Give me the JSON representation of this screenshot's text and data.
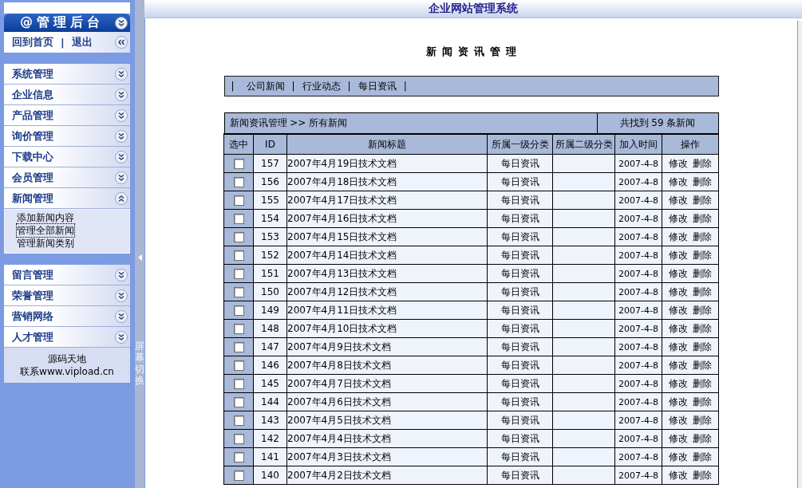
{
  "sidebar": {
    "header": {
      "title": "@管理后台"
    },
    "home_bar": {
      "links": [
        "回到首页",
        "退出"
      ],
      "separators": [
        "|"
      ]
    },
    "menu_groups": [
      {
        "items": [
          {
            "label": "系统管理",
            "expanded": false
          },
          {
            "label": "企业信息",
            "expanded": false
          },
          {
            "label": "产品管理",
            "expanded": false
          },
          {
            "label": "询价管理",
            "expanded": false
          },
          {
            "label": "下载中心",
            "expanded": false
          },
          {
            "label": "会员管理",
            "expanded": false
          },
          {
            "label": "新闻管理",
            "expanded": true,
            "children": [
              {
                "label": "添加新闻内容",
                "focused": false
              },
              {
                "label": "管理全部新闻",
                "focused": true
              },
              {
                "label": "管理新闻类别",
                "focused": false
              }
            ]
          }
        ]
      },
      {
        "items": [
          {
            "label": "留言管理",
            "expanded": false
          },
          {
            "label": "荣誉管理",
            "expanded": false
          },
          {
            "label": "营销网络",
            "expanded": false
          },
          {
            "label": "人才管理",
            "expanded": false
          }
        ],
        "footer": [
          "源码天地",
          "联系www.vipload.cn"
        ]
      }
    ]
  },
  "side_toggle": {
    "label": "屏幕切换"
  },
  "header": {
    "title": "企业网站管理系统"
  },
  "page_title": "新闻资讯管理",
  "category_nav": {
    "separators": [
      "|",
      "|",
      "|",
      "|"
    ],
    "links": [
      "公司新闻",
      "行业动态",
      "每日资讯"
    ]
  },
  "table": {
    "breadcrumb": "新闻资讯管理 >> 所有新闻",
    "count": "共找到 59 条新闻",
    "columns": [
      "选中",
      "ID",
      "新闻标题",
      "所属一级分类",
      "所属二级分类",
      "加入时间",
      "操作"
    ],
    "rows": [
      {
        "checked": false,
        "id": "157",
        "title": "2007年4月19日技术文档",
        "category": "每日资讯",
        "date": "2007-4-8",
        "actions": [
          "修改",
          "删除"
        ]
      },
      {
        "checked": false,
        "id": "156",
        "title": "2007年4月18日技术文档",
        "category": "每日资讯",
        "date": "2007-4-8",
        "actions": [
          "修改",
          "删除"
        ]
      },
      {
        "checked": false,
        "id": "155",
        "title": "2007年4月17日技术文档",
        "category": "每日资讯",
        "date": "2007-4-8",
        "actions": [
          "修改",
          "删除"
        ]
      },
      {
        "checked": false,
        "id": "154",
        "title": "2007年4月16日技术文档",
        "category": "每日资讯",
        "date": "2007-4-8",
        "actions": [
          "修改",
          "删除"
        ]
      },
      {
        "checked": false,
        "id": "153",
        "title": "2007年4月15日技术文档",
        "category": "每日资讯",
        "date": "2007-4-8",
        "actions": [
          "修改",
          "删除"
        ]
      },
      {
        "checked": false,
        "id": "152",
        "title": "2007年4月14日技术文档",
        "category": "每日资讯",
        "date": "2007-4-8",
        "actions": [
          "修改",
          "删除"
        ]
      },
      {
        "checked": false,
        "id": "151",
        "title": "2007年4月13日技术文档",
        "category": "每日资讯",
        "date": "2007-4-8",
        "actions": [
          "修改",
          "删除"
        ]
      },
      {
        "checked": false,
        "id": "150",
        "title": "2007年4月12日技术文档",
        "category": "每日资讯",
        "date": "2007-4-8",
        "actions": [
          "修改",
          "删除"
        ]
      },
      {
        "checked": false,
        "id": "149",
        "title": "2007年4月11日技术文档",
        "category": "每日资讯",
        "date": "2007-4-8",
        "actions": [
          "修改",
          "删除"
        ]
      },
      {
        "checked": false,
        "id": "148",
        "title": "2007年4月10日技术文档",
        "category": "每日资讯",
        "date": "2007-4-8",
        "actions": [
          "修改",
          "删除"
        ]
      },
      {
        "checked": false,
        "id": "147",
        "title": "2007年4月9日技术文档",
        "category": "每日资讯",
        "date": "2007-4-8",
        "actions": [
          "修改",
          "删除"
        ]
      },
      {
        "checked": false,
        "id": "146",
        "title": "2007年4月8日技术文档",
        "category": "每日资讯",
        "date": "2007-4-8",
        "actions": [
          "修改",
          "删除"
        ]
      },
      {
        "checked": false,
        "id": "145",
        "title": "2007年4月7日技术文档",
        "category": "每日资讯",
        "date": "2007-4-8",
        "actions": [
          "修改",
          "删除"
        ]
      },
      {
        "checked": false,
        "id": "144",
        "title": "2007年4月6日技术文档",
        "category": "每日资讯",
        "date": "2007-4-8",
        "actions": [
          "修改",
          "删除"
        ]
      },
      {
        "checked": false,
        "id": "143",
        "title": "2007年4月5日技术文档",
        "category": "每日资讯",
        "date": "2007-4-8",
        "actions": [
          "修改",
          "删除"
        ]
      },
      {
        "checked": false,
        "id": "142",
        "title": "2007年4月4日技术文档",
        "category": "每日资讯",
        "date": "2007-4-8",
        "actions": [
          "修改",
          "删除"
        ]
      },
      {
        "checked": false,
        "id": "141",
        "title": "2007年4月3日技术文档",
        "category": "每日资讯",
        "date": "2007-4-8",
        "actions": [
          "修改",
          "删除"
        ]
      },
      {
        "checked": false,
        "id": "140",
        "title": "2007年4月2日技术文档",
        "category": "每日资讯",
        "date": "2007-4-8",
        "actions": [
          "修改",
          "删除"
        ]
      }
    ]
  }
}
